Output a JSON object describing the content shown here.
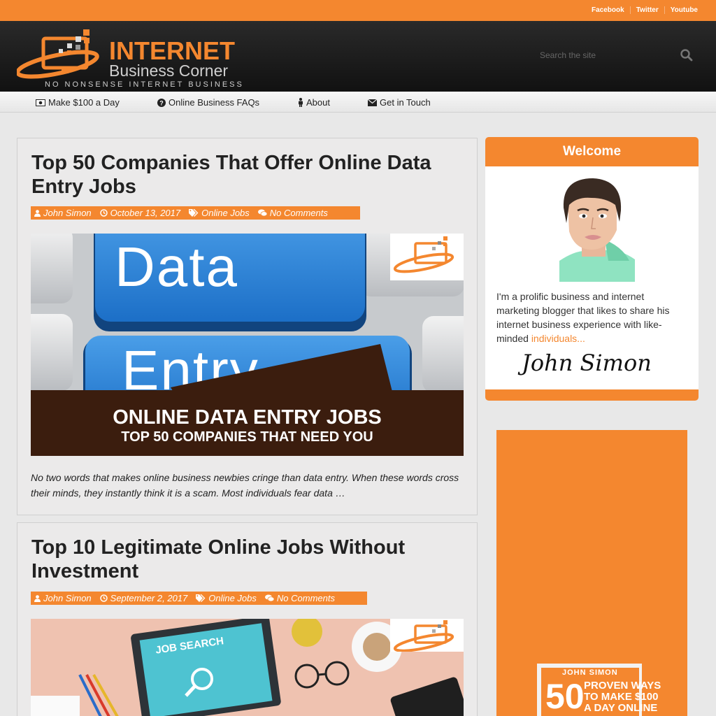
{
  "social": [
    "Facebook",
    "Twitter",
    "Youtube"
  ],
  "logo": {
    "word": "INTERNET",
    "sub": "Business Corner",
    "tagline": "NO NONSENSE INTERNET BUSINESS"
  },
  "search": {
    "placeholder": "Search the site"
  },
  "nav": [
    {
      "label": "Make $100 a Day",
      "icon": "money-icon"
    },
    {
      "label": "Online Business FAQs",
      "icon": "question-circle-icon"
    },
    {
      "label": "About",
      "icon": "person-icon"
    },
    {
      "label": "Get in Touch",
      "icon": "envelope-icon"
    }
  ],
  "posts": [
    {
      "title": "Top 50 Companies That Offer Online Data Entry Jobs",
      "author": "John Simon",
      "date": "October 13, 2017",
      "category": "Online Jobs",
      "comments": "No Comments",
      "image_line1": "ONLINE DATA ENTRY JOBS",
      "image_line2": "TOP 50 COMPANIES THAT NEED YOU",
      "image_key_top": "Data",
      "image_key_bottom": "Entry",
      "excerpt": "No two words that makes online business newbies cringe than data entry. When these words cross their minds, they instantly think it is a scam. Most individuals fear data …"
    },
    {
      "title": "Top 10 Legitimate Online Jobs Without Investment",
      "author": "John Simon",
      "date": "September 2, 2017",
      "category": "Online Jobs",
      "comments": "No Comments",
      "image_screen_text": "JOB SEARCH"
    }
  ],
  "sidebar": {
    "welcome_title": "Welcome",
    "bio": "I'm a prolific business and internet marketing blogger that likes to share his internet business experience with like-minded ",
    "bio_link": "individuals...",
    "signature": "John Simon",
    "book": {
      "author": "JOHN SIMON",
      "number": "50",
      "line1": "PROVEN WAYS",
      "line2": "TO MAKE $100",
      "line3": "A DAY ONLINE"
    }
  },
  "colors": {
    "accent": "#f4872f",
    "header_bg": "#1a1a1a",
    "page_bg": "#e8e8e8"
  }
}
